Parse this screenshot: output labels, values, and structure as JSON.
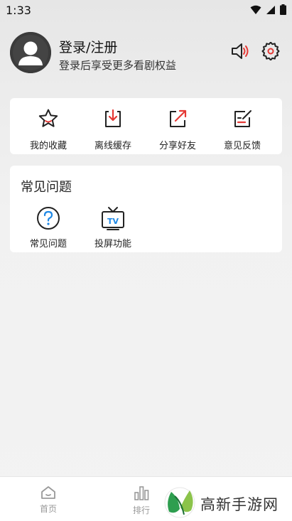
{
  "status_bar": {
    "time": "1:33"
  },
  "profile": {
    "name": "登录/注册",
    "subtitle": "登录后享受更多看剧权益"
  },
  "quick_actions": [
    {
      "label": "我的收藏",
      "icon": "star-icon"
    },
    {
      "label": "离线缓存",
      "icon": "download-icon"
    },
    {
      "label": "分享好友",
      "icon": "share-icon"
    },
    {
      "label": "意见反馈",
      "icon": "feedback-icon"
    }
  ],
  "faq_card": {
    "title": "常见问题",
    "items": [
      {
        "label": "常见问题",
        "icon": "question-icon"
      },
      {
        "label": "投屏功能",
        "icon": "tv-icon",
        "icon_text": "TV"
      }
    ]
  },
  "tab_bar": [
    {
      "label": "首页",
      "icon": "home-icon"
    },
    {
      "label": "排行",
      "icon": "ranking-icon"
    }
  ],
  "watermark": {
    "text": "高新手游网"
  },
  "colors": {
    "accent_red": "#e53935",
    "dark": "#222222",
    "tab_inactive": "#999999"
  }
}
